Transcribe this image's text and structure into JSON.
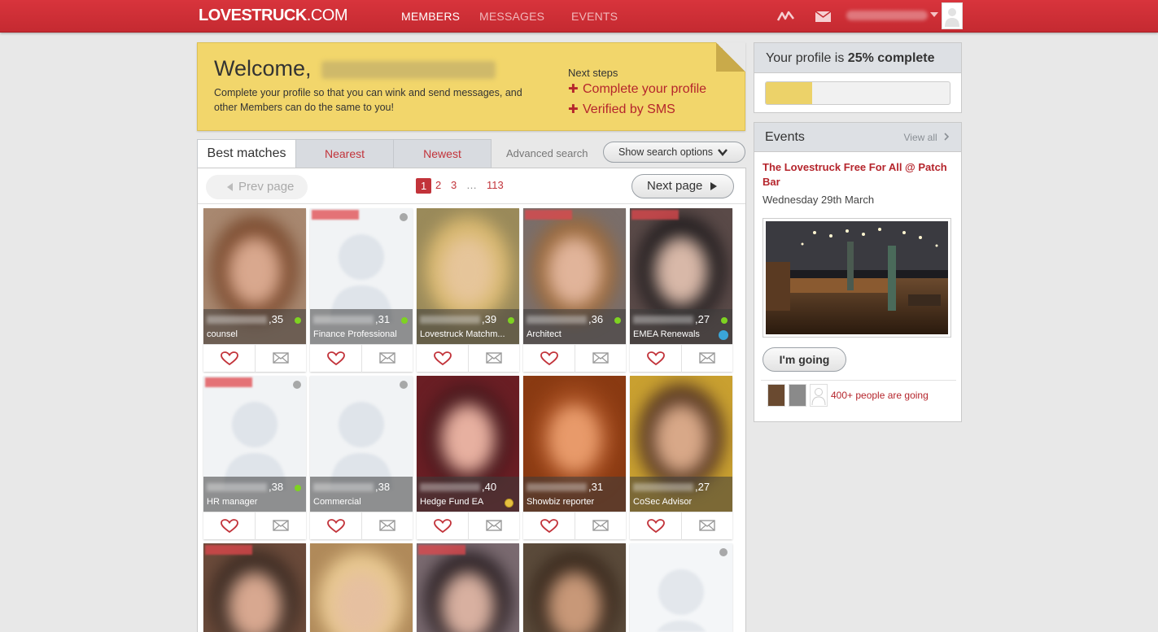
{
  "header": {
    "logo": "LOVESTRUCK",
    "logo_suffix": ".COM",
    "nav": {
      "members": "MEMBERS",
      "messages": "MESSAGES",
      "events": "EVENTS"
    }
  },
  "welcome": {
    "greeting": "Welcome,",
    "message": "Complete your profile so that you can wink and send messages, and other Members can do the same to you!",
    "next_steps_label": "Next steps",
    "step1": "Complete your profile",
    "step2": "Verified by SMS"
  },
  "tabs": {
    "best_matches": "Best matches",
    "nearest": "Nearest",
    "newest": "Newest",
    "advanced_search": "Advanced search",
    "show_options": "Show search options"
  },
  "pager": {
    "prev": "Prev page",
    "next": "Next page",
    "pages": [
      "1",
      "2",
      "3",
      "…",
      "113"
    ]
  },
  "cards": [
    {
      "age": ",35",
      "job": "counsel",
      "online": true
    },
    {
      "age": ",31",
      "job": "Finance Professional",
      "online": true
    },
    {
      "age": ",39",
      "job": "Lovestruck Matchm...",
      "online": true
    },
    {
      "age": ",36",
      "job": "Architect",
      "online": true
    },
    {
      "age": ",27",
      "job": "EMEA Renewals",
      "online": true
    },
    {
      "age": ",38",
      "job": "HR manager",
      "online": true
    },
    {
      "age": ",38",
      "job": "Commercial",
      "online": false
    },
    {
      "age": ",40",
      "job": "Hedge Fund EA",
      "online": false
    },
    {
      "age": ",31",
      "job": "Showbiz reporter",
      "online": false
    },
    {
      "age": ",27",
      "job": "CoSec Advisor",
      "online": false
    }
  ],
  "profile": {
    "prefix": "Your profile is ",
    "percent_text": "25% complete",
    "progress": 0.25
  },
  "events": {
    "title": "Events",
    "view_all": "View all",
    "event_name": "The Lovestruck Free For All @ Patch Bar",
    "event_date": "Wednesday 29th March",
    "going_button": "I'm going",
    "going_count": "400+ people are going"
  },
  "colors": {
    "brand_red": "#c52a31",
    "banner_yellow": "#f2d66b",
    "link_red": "#b5252c"
  }
}
